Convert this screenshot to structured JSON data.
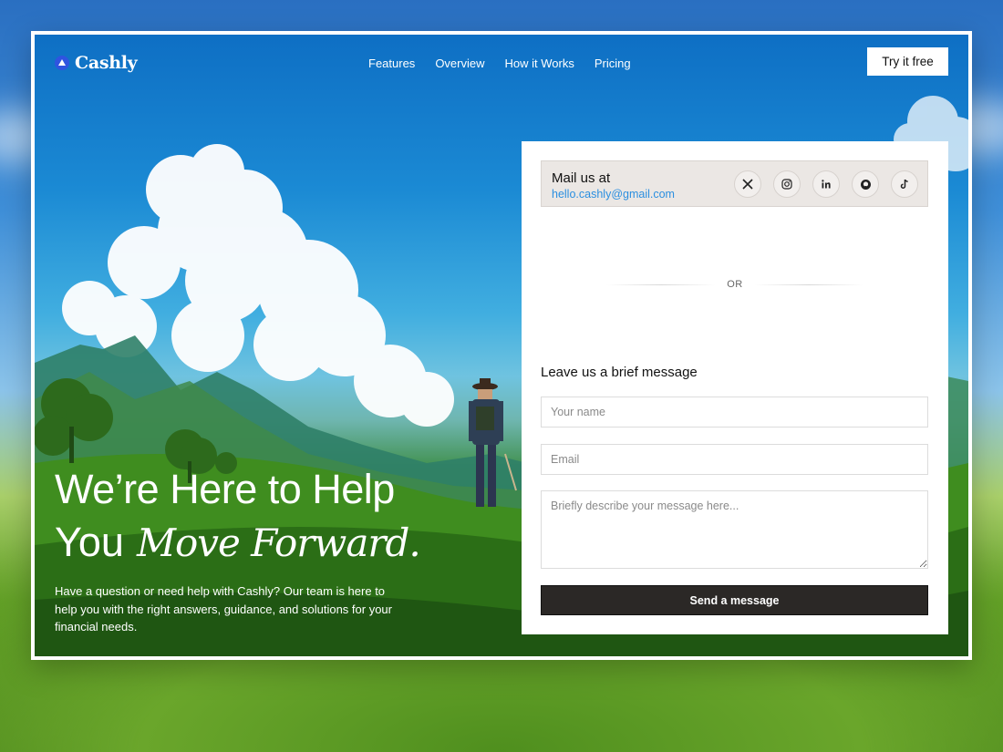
{
  "brand": {
    "name": "Cashly"
  },
  "nav": {
    "links": [
      "Features",
      "Overview",
      "How it Works",
      "Pricing"
    ],
    "cta_label": "Try it free"
  },
  "hero": {
    "headline_line1": "We’re Here to Help",
    "headline_line2_plain": "You",
    "headline_line2_italic": "Move Forward.",
    "description": "Have a question or need help with Cashly? Our team is here to help you with the right answers, guidance, and solutions for your financial needs."
  },
  "contact": {
    "mail_title": "Mail us at",
    "mail_email": "hello.cashly@gmail.com",
    "socials": [
      "x-icon",
      "instagram-icon",
      "linkedin-icon",
      "github-icon",
      "tiktok-icon"
    ],
    "divider_text": "OR",
    "form_title": "Leave us a brief message",
    "name_placeholder": "Your name",
    "email_placeholder": "Email",
    "message_placeholder": "Briefly describe your message here...",
    "submit_label": "Send a message"
  },
  "colors": {
    "brand_blue": "#2f54e0",
    "link_blue": "#2b8fe0",
    "button_dark": "#2b2826",
    "mail_box_bg": "#ebe7e4"
  }
}
